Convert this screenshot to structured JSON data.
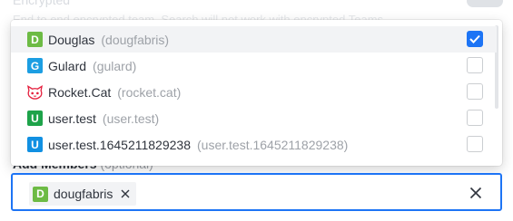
{
  "form": {
    "encrypted_label": "Encrypted",
    "encrypted_desc": "End to end encrypted team. Search will not work with encrypted Teams",
    "add_members_label": "Add Members",
    "add_members_optional": "(optional)"
  },
  "options": [
    {
      "avatar_letter": "D",
      "avatar_color": "#6dbb45",
      "name": "Douglas",
      "username": "(dougfabris)",
      "checked": true
    },
    {
      "avatar_letter": "G",
      "avatar_color": "#1c9ee2",
      "name": "Gulard",
      "username": "(gulard)",
      "checked": false
    },
    {
      "avatar_letter": "",
      "avatar_icon": "rocket-cat-icon",
      "avatar_color": "#e5213f",
      "name": "Rocket.Cat",
      "username": "(rocket.cat)",
      "checked": false
    },
    {
      "avatar_letter": "U",
      "avatar_color": "#1ea34a",
      "name": "user.test",
      "username": "(user.test)",
      "checked": false
    },
    {
      "avatar_letter": "U",
      "avatar_color": "#1190e2",
      "name": "user.test.1645211829238",
      "username": "(user.test.1645211829238)",
      "checked": false
    }
  ],
  "chips": [
    {
      "avatar_letter": "D",
      "avatar_color": "#6dbb45",
      "label": "dougfabris"
    }
  ],
  "colors": {
    "accent": "#1d74f5"
  }
}
